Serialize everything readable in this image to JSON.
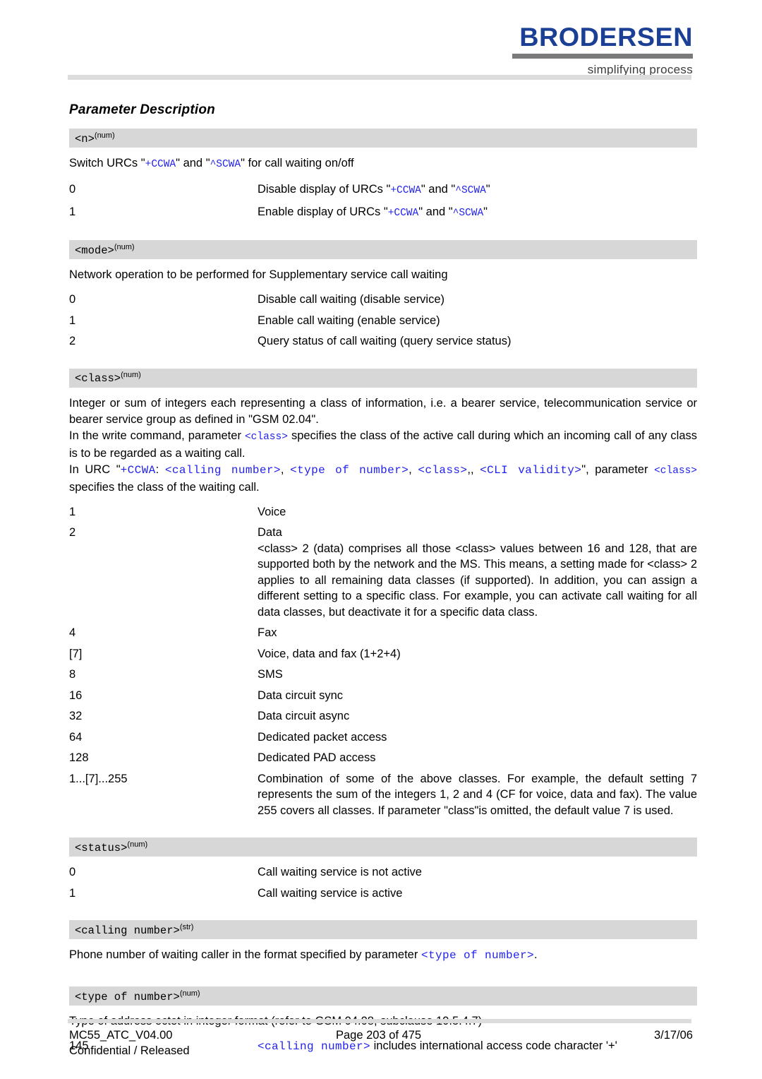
{
  "brand": {
    "name": "BRODERSEN",
    "tagline": "simplifying process",
    "logo_color": "#1a3f94",
    "bar_color": "#7a7a7a"
  },
  "heading": "Parameter Description",
  "code_color": "#2222ee",
  "bar_bg": "#d7d7d7",
  "sections": [
    {
      "id": "n",
      "name": "<n>",
      "sup": "(num)",
      "intro_parts": [
        {
          "t": "Switch URCs \"",
          "k": "text"
        },
        {
          "t": "+CCWA",
          "k": "code"
        },
        {
          "t": "\" and \"",
          "k": "text"
        },
        {
          "t": "^SCWA",
          "k": "code"
        },
        {
          "t": "\" for call waiting on/off",
          "k": "text"
        }
      ],
      "rows": [
        {
          "value": "0",
          "parts": [
            {
              "t": "Disable display of URCs \"",
              "k": "text"
            },
            {
              "t": "+CCWA",
              "k": "code"
            },
            {
              "t": "\" and \"",
              "k": "text"
            },
            {
              "t": "^SCWA",
              "k": "code"
            },
            {
              "t": "\"",
              "k": "text"
            }
          ]
        },
        {
          "value": "1",
          "parts": [
            {
              "t": "Enable display of URCs \"",
              "k": "text"
            },
            {
              "t": "+CCWA",
              "k": "code"
            },
            {
              "t": "\" and \"",
              "k": "text"
            },
            {
              "t": "^SCWA",
              "k": "code"
            },
            {
              "t": "\"",
              "k": "text"
            }
          ]
        }
      ]
    },
    {
      "id": "mode",
      "name": "<mode>",
      "sup": "(num)",
      "intro_parts": [
        {
          "t": "Network operation to be performed for Supplementary service call waiting",
          "k": "text"
        }
      ],
      "rows": [
        {
          "value": "0",
          "parts": [
            {
              "t": "Disable call waiting (disable service)",
              "k": "text"
            }
          ]
        },
        {
          "value": "1",
          "parts": [
            {
              "t": "Enable call waiting (enable service)",
              "k": "text"
            }
          ]
        },
        {
          "value": "2",
          "parts": [
            {
              "t": "Query status of call waiting (query service status)",
              "k": "text"
            }
          ]
        }
      ]
    },
    {
      "id": "class",
      "name": "<class>",
      "sup": "(num)",
      "paragraphs": [
        [
          {
            "t": "Integer or sum of integers each representing a class of information, i.e. a bearer service, telecommunication service or bearer service group as defined in \"GSM 02.04\".",
            "k": "text"
          }
        ],
        [
          {
            "t": "In the write command, parameter ",
            "k": "text"
          },
          {
            "t": "<class>",
            "k": "code"
          },
          {
            "t": " specifies the class of the active call during which an incoming call of any class is to be regarded as a waiting call.",
            "k": "text"
          }
        ],
        [
          {
            "t": "In URC \"",
            "k": "text"
          },
          {
            "t": "+CCWA",
            "k": "code-lg"
          },
          {
            "t": ": ",
            "k": "text"
          },
          {
            "t": "<calling number>",
            "k": "code-lg"
          },
          {
            "t": ", ",
            "k": "text"
          },
          {
            "t": "<type of number>",
            "k": "code-lg"
          },
          {
            "t": ", ",
            "k": "text"
          },
          {
            "t": "<class>",
            "k": "code-lg"
          },
          {
            "t": ",, ",
            "k": "text"
          },
          {
            "t": "<CLI validity>",
            "k": "code-lg"
          },
          {
            "t": "\", parameter ",
            "k": "text"
          },
          {
            "t": "<class>",
            "k": "code"
          },
          {
            "t": " specifies the class of the waiting call.",
            "k": "text"
          }
        ]
      ],
      "rows": [
        {
          "value": "1",
          "parts": [
            {
              "t": "Voice",
              "k": "text"
            }
          ]
        },
        {
          "value": "2",
          "parts": [
            {
              "t": "Data",
              "k": "text"
            },
            {
              "t": "\n",
              "k": "br"
            },
            {
              "t": "<class> 2 (data) comprises all those <class> values between 16 and 128, that are supported both by the network and the MS. This means, a setting made for <class> 2 applies to all remaining data classes (if supported). In addition, you can assign a different setting to a specific class. For example, you can activate call waiting for all data classes, but deactivate it for a specific data class.",
              "k": "text"
            }
          ]
        },
        {
          "value": "4",
          "parts": [
            {
              "t": "Fax",
              "k": "text"
            }
          ]
        },
        {
          "value": "[7]",
          "parts": [
            {
              "t": "Voice, data and fax (1+2+4)",
              "k": "text"
            }
          ]
        },
        {
          "value": "8",
          "parts": [
            {
              "t": "SMS",
              "k": "text"
            }
          ]
        },
        {
          "value": "16",
          "parts": [
            {
              "t": "Data circuit sync",
              "k": "text"
            }
          ]
        },
        {
          "value": "32",
          "parts": [
            {
              "t": "Data circuit async",
              "k": "text"
            }
          ]
        },
        {
          "value": "64",
          "parts": [
            {
              "t": "Dedicated packet access",
              "k": "text"
            }
          ]
        },
        {
          "value": "128",
          "parts": [
            {
              "t": "Dedicated PAD access",
              "k": "text"
            }
          ]
        },
        {
          "value": "1...[7]...255",
          "parts": [
            {
              "t": "Combination of some of the above classes. For example, the default setting 7 represents the sum of the integers 1, 2 and 4 (CF for voice, data and fax). The value 255 covers all classes. If parameter \"class\"is omitted, the default value 7 is used.",
              "k": "text"
            }
          ]
        }
      ]
    },
    {
      "id": "status",
      "name": "<status>",
      "sup": "(num)",
      "rows": [
        {
          "value": "0",
          "parts": [
            {
              "t": "Call waiting service is not active",
              "k": "text"
            }
          ]
        },
        {
          "value": "1",
          "parts": [
            {
              "t": "Call waiting service is active",
              "k": "text"
            }
          ]
        }
      ]
    },
    {
      "id": "calling-number",
      "name": "<calling number>",
      "sup": "(str)",
      "intro_parts": [
        {
          "t": "Phone number of waiting caller in the format specified by parameter ",
          "k": "text"
        },
        {
          "t": "<type of number>",
          "k": "code-lg"
        },
        {
          "t": ".",
          "k": "text"
        }
      ],
      "rows": []
    },
    {
      "id": "type-of-number",
      "name": "<type of number>",
      "sup": "(num)",
      "intro_parts": [
        {
          "t": "Type of address octet in integer format (refer to GSM 04.08, subclause 10.5.4.7)",
          "k": "text"
        }
      ],
      "rows": [
        {
          "value": "145",
          "parts": [
            {
              "t": "<calling number>",
              "k": "code-lg"
            },
            {
              "t": " includes international access code character '+'",
              "k": "text"
            }
          ]
        }
      ]
    }
  ],
  "footer": {
    "doc_id": "MC55_ATC_V04.00",
    "classification": "Confidential / Released",
    "page": "Page 203 of 475",
    "date": "3/17/06"
  }
}
